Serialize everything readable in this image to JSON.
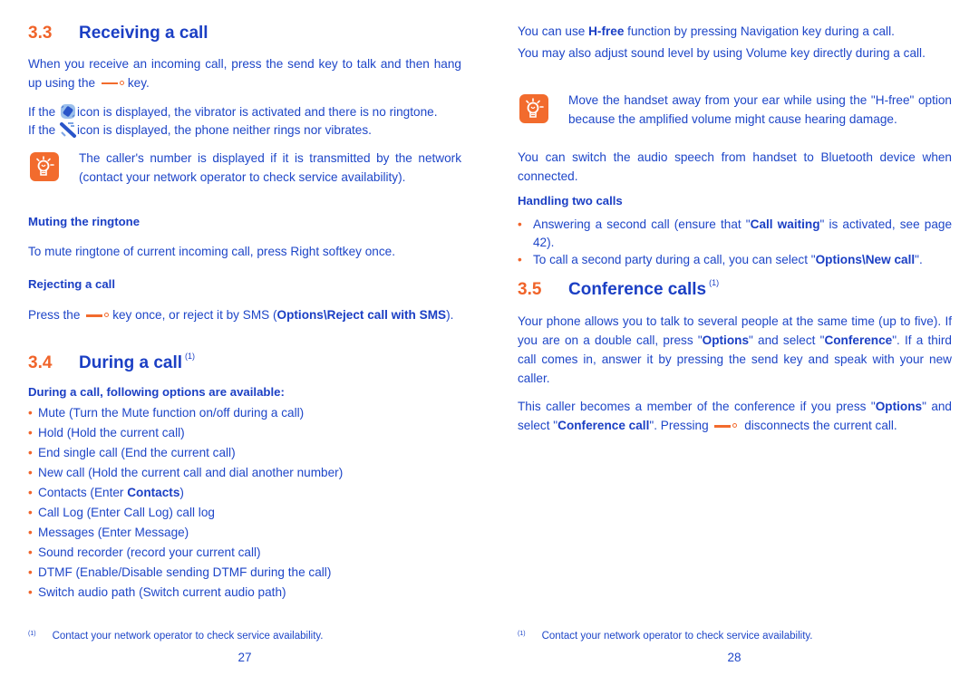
{
  "left_page": {
    "section_3_3": {
      "number": "3.3",
      "title": "Receiving a call",
      "para1_before_key": "When you receive an incoming call, press the send key to talk and then hang up using the",
      "para1_after_key": "key.",
      "para2_before_icon": "If the",
      "para2_after_icon": "icon is displayed, the vibrator is activated and there is no ringtone.",
      "para3_before_icon": "If the",
      "para3_after_icon": "icon is displayed, the phone neither rings nor vibrates.",
      "tip_text": "The caller's number is displayed if it is transmitted by the network (contact your network operator to check service availability).",
      "muting_heading": "Muting the ringtone",
      "muting_text": "To mute ringtone of current incoming call, press Right softkey once.",
      "rejecting_heading": "Rejecting a call",
      "rejecting_before_key": "Press the",
      "rejecting_after_key": "key once, or reject it by SMS (",
      "rejecting_bold": "Options\\Reject call with SMS",
      "rejecting_end": ")."
    },
    "section_3_4": {
      "number": "3.4",
      "title": "During a call",
      "footnote_marker": "(1)",
      "subheading": "During a call, following options are available:",
      "options": [
        {
          "text": "Mute (Turn the Mute function on/off during a call)"
        },
        {
          "text": "Hold (Hold the current call)"
        },
        {
          "text": "End single call (End the current call)"
        },
        {
          "text": "New call (Hold the current call and dial another number)"
        },
        {
          "text": "Contacts (Enter ",
          "bold": "Contacts",
          "after": ")"
        },
        {
          "text": "Call Log (Enter Call Log) call log"
        },
        {
          "text": "Messages (Enter Message)"
        },
        {
          "text": "Sound recorder (record your current call)"
        },
        {
          "text": "DTMF (Enable/Disable sending DTMF during the call)"
        },
        {
          "text": "Switch audio path (Switch current audio path)"
        }
      ]
    },
    "footnote": {
      "marker": "(1)",
      "text": "Contact your network operator to check service availability."
    },
    "page_number": "27"
  },
  "right_page": {
    "hfree_before": "You can use",
    "hfree_bold": "H-free",
    "hfree_after": "function by pressing Navigation key during a call.",
    "volume_text": "You may also adjust sound level by using Volume key directly during a call.",
    "tip_text": "Move the handset away from your ear while using the \"H-free\" option because the amplified volume might cause hearing damage.",
    "bluetooth_text": "You can switch the audio speech from handset to Bluetooth device when connected.",
    "handling_heading": "Handling two calls",
    "handling_items": [
      {
        "before": "Answering a second call (ensure that \"",
        "bold": "Call waiting",
        "after": "\" is activated, see page 42)."
      },
      {
        "before": "To call a second party during a call, you can select \"",
        "bold": "Options\\New call",
        "after": "\"."
      }
    ],
    "section_3_5": {
      "number": "3.5",
      "title": "Conference calls",
      "footnote_marker": "(1)",
      "para1_a": "Your phone allows you to talk to several people at the same time (up to five). If you are on a double call, press \"",
      "para1_bold1": "Options",
      "para1_b": "\" and select \"",
      "para1_bold2": "Conference",
      "para1_c": "\". If a third call comes in, answer it by pressing the send key and speak with your new caller.",
      "para2_a": "This caller becomes a member of the conference if you press \"",
      "para2_bold1": "Options",
      "para2_b": "\" and select \"",
      "para2_bold2": "Conference call",
      "para2_c": "\". Pressing",
      "para2_d": "disconnects the current call."
    },
    "footnote": {
      "marker": "(1)",
      "text": "Contact your network operator to check service availability."
    },
    "page_number": "28"
  },
  "icons": {
    "tip": "lightbulb-tip-icon",
    "end_key": "end-call-key-icon",
    "vibrate": "vibrate-mode-icon",
    "silent": "silent-mode-icon"
  },
  "colors": {
    "accent_orange": "#f26b2d",
    "text_blue": "#1e46c8",
    "heading_blue": "#1b3fc4"
  }
}
